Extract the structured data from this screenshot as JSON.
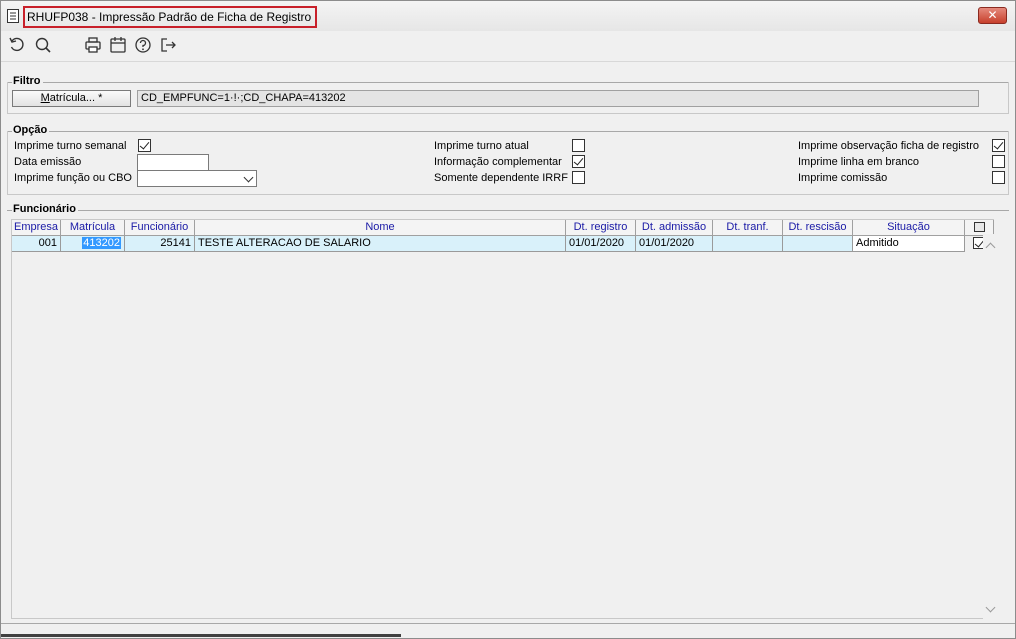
{
  "window": {
    "title": "RHUFP038 - Impressão Padrão de Ficha de Registro",
    "close_label": "✕"
  },
  "toolbar": {
    "items": [
      {
        "name": "refresh-icon"
      },
      {
        "name": "search-icon"
      },
      {
        "name": "print-icon"
      },
      {
        "name": "calendar-icon"
      },
      {
        "name": "help-icon"
      },
      {
        "name": "exit-icon"
      }
    ]
  },
  "filtro": {
    "group_label": "Filtro",
    "button_label_underlined": "M",
    "button_label_rest": "atrícula... *",
    "value": "CD_EMPFUNC=1·!·;CD_CHAPA=413202"
  },
  "opcao": {
    "group_label": "Opção",
    "col1": {
      "imprime_turno_semanal": {
        "label": "Imprime turno semanal",
        "checked": true
      },
      "data_emissao": {
        "label": "Data emissão",
        "value": ""
      },
      "imprime_funcao_cbo": {
        "label": "Imprime função ou CBO",
        "value": ""
      }
    },
    "col2": {
      "imprime_turno_atual": {
        "label": "Imprime turno atual",
        "checked": false
      },
      "informacao_complementar": {
        "label": "Informação complementar",
        "checked": true
      },
      "somente_dependente_irrf": {
        "label": "Somente dependente IRRF",
        "checked": false
      }
    },
    "col3": {
      "imprime_observacao": {
        "label": "Imprime observação ficha de registro",
        "checked": true
      },
      "imprime_linha_branco": {
        "label": "Imprime linha em branco",
        "checked": false
      },
      "imprime_comissao": {
        "label": "Imprime comissão",
        "checked": false
      }
    }
  },
  "funcionario": {
    "group_label": "Funcionário",
    "columns": [
      "Empresa",
      "Matrícula",
      "Funcionário",
      "Nome",
      "Dt. registro",
      "Dt. admissão",
      "Dt. tranf.",
      "Dt. rescisão",
      "Situação"
    ],
    "rows": [
      {
        "empresa": "001",
        "matricula": "413202",
        "funcionario": "25141",
        "nome": "TESTE ALTERACAO DE SALARIO",
        "dt_registro": "01/01/2020",
        "dt_admissao": "01/01/2020",
        "dt_tranf": "",
        "dt_rescisao": "",
        "situacao": "Admitido",
        "checked": true
      }
    ]
  },
  "colors": {
    "title_highlight": "#c8202a",
    "header_text": "#1a1aa6",
    "row_bg": "#d9f1fa",
    "selection": "#3399ff"
  }
}
